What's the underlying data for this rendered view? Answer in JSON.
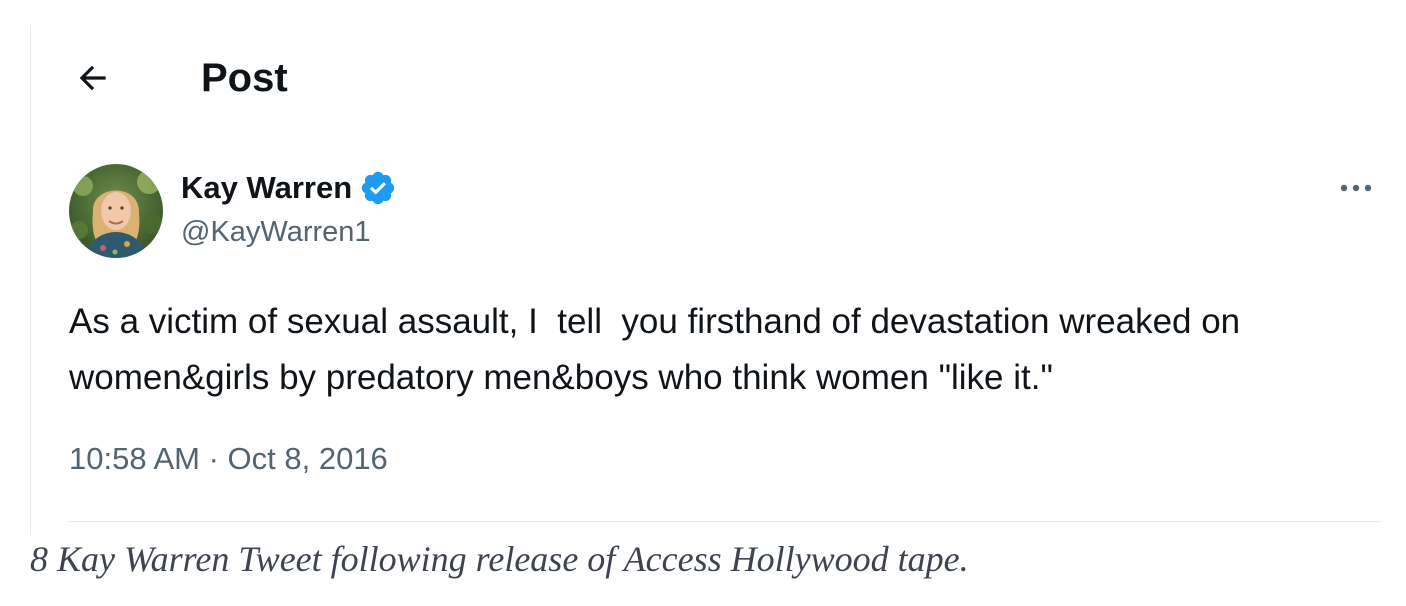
{
  "header": {
    "back_icon": "arrow-left-icon",
    "title": "Post"
  },
  "post": {
    "author": {
      "name": "Kay Warren",
      "handle": "@KayWarren1",
      "verified": true,
      "verified_icon": "verified-badge-icon",
      "verified_color": "#1d9bf0"
    },
    "more_icon": "more-horizontal-icon",
    "text": "As a victim of sexual assault, I  tell  you firsthand of devastation wreaked on women&girls by predatory men&boys who think women \"like it.\"",
    "timestamp": "10:58 AM · Oct 8, 2016"
  },
  "caption": "8 Kay Warren Tweet following release of Access Hollywood tape.",
  "colors": {
    "text_primary": "#0f1419",
    "text_secondary": "#536471",
    "verified_blue": "#1d9bf0",
    "divider": "#e6e9ec"
  }
}
